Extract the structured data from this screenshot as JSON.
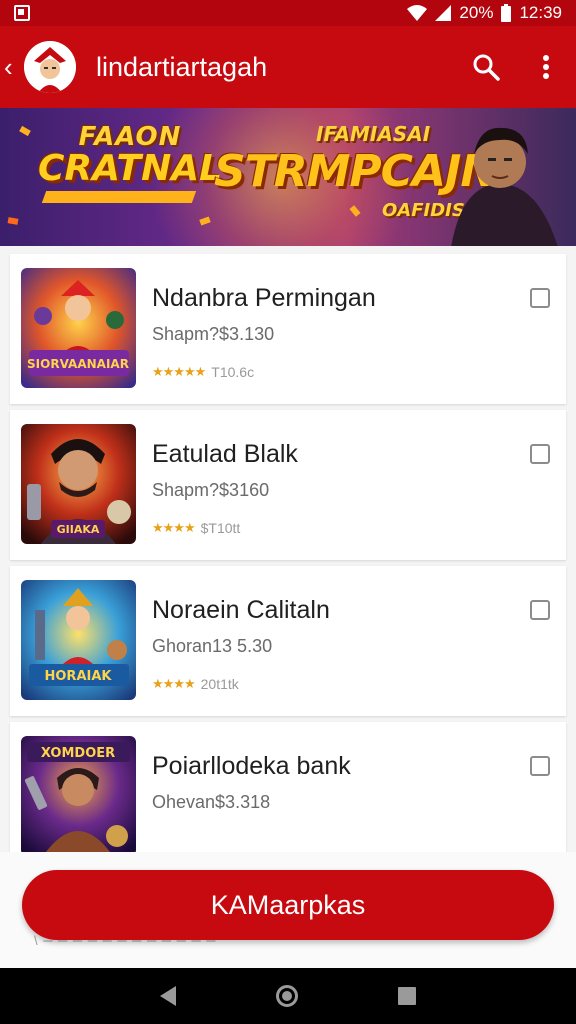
{
  "status_bar": {
    "battery": "20%",
    "time": "12:39"
  },
  "app_bar": {
    "title": "lindartiartagah",
    "icons": [
      "back-icon",
      "avatar",
      "search-icon",
      "more-vert-icon"
    ]
  },
  "banner": {
    "left_line1": "FAAON",
    "left_line2": "CRATNAL",
    "mid_top": "IFAMIASAI",
    "mid_main": "STRMPCAJN",
    "mid_bottom": "OAFIDISIAY"
  },
  "items": [
    {
      "title": "Ndanbra Permingan",
      "price": "Shapm?$3.130",
      "rating_text": "T10.6c",
      "stars": "★★★★★"
    },
    {
      "title": "Eatulad Blalk",
      "price": "Shapm?$3160",
      "rating_text": "$T10tt",
      "stars": "★★★★"
    },
    {
      "title": "Noraein Calitaln",
      "price": "Ghoran13 5.30",
      "rating_text": "20t1tk",
      "stars": "★★★★"
    },
    {
      "title": "Poiarllodeka bank",
      "price": "Ohevan$3.318",
      "rating_text": "",
      "stars": ""
    }
  ],
  "thumb_texts": [
    "SIORVAANAIAR",
    "GIIAKA",
    "HORAIAK",
    "XOMDOER"
  ],
  "cta": {
    "label": "KAMaarpkas"
  },
  "faded_text": "\\ ─ ─ ─ ─ ─ ─ ─ ─ ─ ─ ─ ─",
  "colors": {
    "primary": "#c70910",
    "status": "#b3050d",
    "star": "#e8a21a"
  }
}
